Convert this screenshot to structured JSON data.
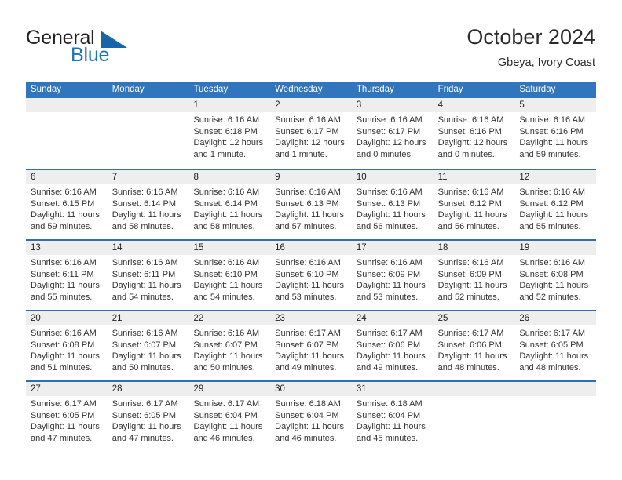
{
  "brand": {
    "line1": "General",
    "line2": "Blue",
    "triangle_icon": "blue-triangle-logo-mark",
    "accent_color": "#1d73bb"
  },
  "header": {
    "title": "October 2024",
    "subtitle": "Gbeya, Ivory Coast"
  },
  "theme": {
    "header_blue": "#3176bc",
    "rule_blue": "#2f6fb0",
    "daynum_strip": "#eeeeee",
    "text": "#333333"
  },
  "weekdays": [
    "Sunday",
    "Monday",
    "Tuesday",
    "Wednesday",
    "Thursday",
    "Friday",
    "Saturday"
  ],
  "weeks": [
    [
      {
        "day": "",
        "sunrise": "",
        "sunset": "",
        "daylight": ""
      },
      {
        "day": "",
        "sunrise": "",
        "sunset": "",
        "daylight": ""
      },
      {
        "day": "1",
        "sunrise": "Sunrise: 6:16 AM",
        "sunset": "Sunset: 6:18 PM",
        "daylight": "Daylight: 12 hours and 1 minute."
      },
      {
        "day": "2",
        "sunrise": "Sunrise: 6:16 AM",
        "sunset": "Sunset: 6:17 PM",
        "daylight": "Daylight: 12 hours and 1 minute."
      },
      {
        "day": "3",
        "sunrise": "Sunrise: 6:16 AM",
        "sunset": "Sunset: 6:17 PM",
        "daylight": "Daylight: 12 hours and 0 minutes."
      },
      {
        "day": "4",
        "sunrise": "Sunrise: 6:16 AM",
        "sunset": "Sunset: 6:16 PM",
        "daylight": "Daylight: 12 hours and 0 minutes."
      },
      {
        "day": "5",
        "sunrise": "Sunrise: 6:16 AM",
        "sunset": "Sunset: 6:16 PM",
        "daylight": "Daylight: 11 hours and 59 minutes."
      }
    ],
    [
      {
        "day": "6",
        "sunrise": "Sunrise: 6:16 AM",
        "sunset": "Sunset: 6:15 PM",
        "daylight": "Daylight: 11 hours and 59 minutes."
      },
      {
        "day": "7",
        "sunrise": "Sunrise: 6:16 AM",
        "sunset": "Sunset: 6:14 PM",
        "daylight": "Daylight: 11 hours and 58 minutes."
      },
      {
        "day": "8",
        "sunrise": "Sunrise: 6:16 AM",
        "sunset": "Sunset: 6:14 PM",
        "daylight": "Daylight: 11 hours and 58 minutes."
      },
      {
        "day": "9",
        "sunrise": "Sunrise: 6:16 AM",
        "sunset": "Sunset: 6:13 PM",
        "daylight": "Daylight: 11 hours and 57 minutes."
      },
      {
        "day": "10",
        "sunrise": "Sunrise: 6:16 AM",
        "sunset": "Sunset: 6:13 PM",
        "daylight": "Daylight: 11 hours and 56 minutes."
      },
      {
        "day": "11",
        "sunrise": "Sunrise: 6:16 AM",
        "sunset": "Sunset: 6:12 PM",
        "daylight": "Daylight: 11 hours and 56 minutes."
      },
      {
        "day": "12",
        "sunrise": "Sunrise: 6:16 AM",
        "sunset": "Sunset: 6:12 PM",
        "daylight": "Daylight: 11 hours and 55 minutes."
      }
    ],
    [
      {
        "day": "13",
        "sunrise": "Sunrise: 6:16 AM",
        "sunset": "Sunset: 6:11 PM",
        "daylight": "Daylight: 11 hours and 55 minutes."
      },
      {
        "day": "14",
        "sunrise": "Sunrise: 6:16 AM",
        "sunset": "Sunset: 6:11 PM",
        "daylight": "Daylight: 11 hours and 54 minutes."
      },
      {
        "day": "15",
        "sunrise": "Sunrise: 6:16 AM",
        "sunset": "Sunset: 6:10 PM",
        "daylight": "Daylight: 11 hours and 54 minutes."
      },
      {
        "day": "16",
        "sunrise": "Sunrise: 6:16 AM",
        "sunset": "Sunset: 6:10 PM",
        "daylight": "Daylight: 11 hours and 53 minutes."
      },
      {
        "day": "17",
        "sunrise": "Sunrise: 6:16 AM",
        "sunset": "Sunset: 6:09 PM",
        "daylight": "Daylight: 11 hours and 53 minutes."
      },
      {
        "day": "18",
        "sunrise": "Sunrise: 6:16 AM",
        "sunset": "Sunset: 6:09 PM",
        "daylight": "Daylight: 11 hours and 52 minutes."
      },
      {
        "day": "19",
        "sunrise": "Sunrise: 6:16 AM",
        "sunset": "Sunset: 6:08 PM",
        "daylight": "Daylight: 11 hours and 52 minutes."
      }
    ],
    [
      {
        "day": "20",
        "sunrise": "Sunrise: 6:16 AM",
        "sunset": "Sunset: 6:08 PM",
        "daylight": "Daylight: 11 hours and 51 minutes."
      },
      {
        "day": "21",
        "sunrise": "Sunrise: 6:16 AM",
        "sunset": "Sunset: 6:07 PM",
        "daylight": "Daylight: 11 hours and 50 minutes."
      },
      {
        "day": "22",
        "sunrise": "Sunrise: 6:16 AM",
        "sunset": "Sunset: 6:07 PM",
        "daylight": "Daylight: 11 hours and 50 minutes."
      },
      {
        "day": "23",
        "sunrise": "Sunrise: 6:17 AM",
        "sunset": "Sunset: 6:07 PM",
        "daylight": "Daylight: 11 hours and 49 minutes."
      },
      {
        "day": "24",
        "sunrise": "Sunrise: 6:17 AM",
        "sunset": "Sunset: 6:06 PM",
        "daylight": "Daylight: 11 hours and 49 minutes."
      },
      {
        "day": "25",
        "sunrise": "Sunrise: 6:17 AM",
        "sunset": "Sunset: 6:06 PM",
        "daylight": "Daylight: 11 hours and 48 minutes."
      },
      {
        "day": "26",
        "sunrise": "Sunrise: 6:17 AM",
        "sunset": "Sunset: 6:05 PM",
        "daylight": "Daylight: 11 hours and 48 minutes."
      }
    ],
    [
      {
        "day": "27",
        "sunrise": "Sunrise: 6:17 AM",
        "sunset": "Sunset: 6:05 PM",
        "daylight": "Daylight: 11 hours and 47 minutes."
      },
      {
        "day": "28",
        "sunrise": "Sunrise: 6:17 AM",
        "sunset": "Sunset: 6:05 PM",
        "daylight": "Daylight: 11 hours and 47 minutes."
      },
      {
        "day": "29",
        "sunrise": "Sunrise: 6:17 AM",
        "sunset": "Sunset: 6:04 PM",
        "daylight": "Daylight: 11 hours and 46 minutes."
      },
      {
        "day": "30",
        "sunrise": "Sunrise: 6:18 AM",
        "sunset": "Sunset: 6:04 PM",
        "daylight": "Daylight: 11 hours and 46 minutes."
      },
      {
        "day": "31",
        "sunrise": "Sunrise: 6:18 AM",
        "sunset": "Sunset: 6:04 PM",
        "daylight": "Daylight: 11 hours and 45 minutes."
      },
      {
        "day": "",
        "sunrise": "",
        "sunset": "",
        "daylight": ""
      },
      {
        "day": "",
        "sunrise": "",
        "sunset": "",
        "daylight": ""
      }
    ]
  ]
}
